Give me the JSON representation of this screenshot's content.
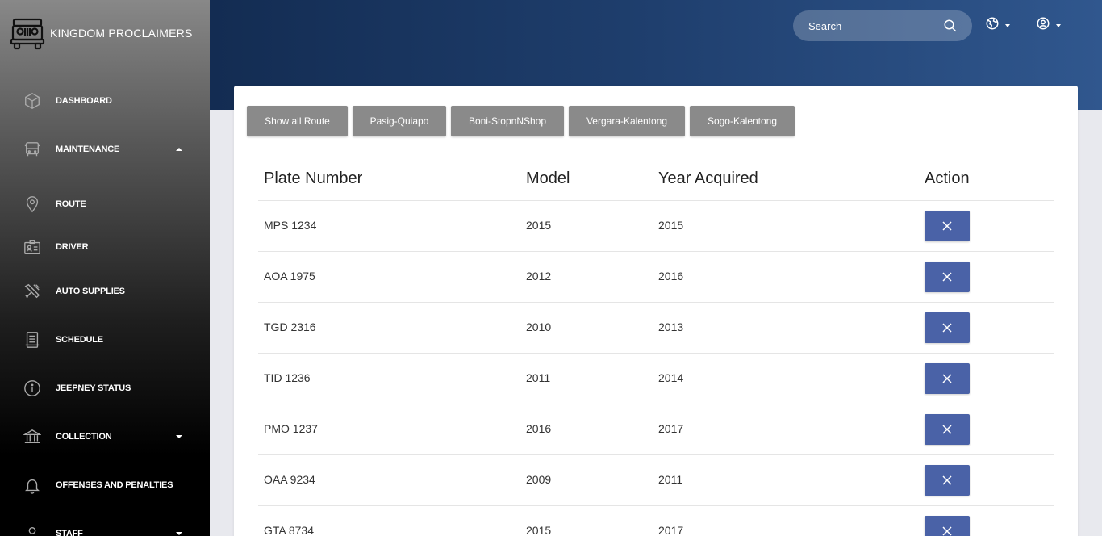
{
  "brand": {
    "name": "KINGDOM PROCLAIMERS",
    "logo_icon": "jeep-icon"
  },
  "nav": [
    {
      "label": "DASHBOARD",
      "icon": "cube-icon",
      "caret": null
    },
    {
      "label": "MAINTENANCE",
      "icon": "bus-icon",
      "caret": "up"
    },
    {
      "label": "ROUTE",
      "icon": "map-pin-icon",
      "caret": null
    },
    {
      "label": "DRIVER",
      "icon": "id-card-icon",
      "caret": null
    },
    {
      "label": "AUTO SUPPLIES",
      "icon": "tools-icon",
      "caret": null
    },
    {
      "label": "SCHEDULE",
      "icon": "document-icon",
      "caret": null
    },
    {
      "label": "JEEPNEY STATUS",
      "icon": "info-icon",
      "caret": null
    },
    {
      "label": "COLLECTION",
      "icon": "bank-icon",
      "caret": "down"
    },
    {
      "label": "OFFENSES AND PENALTIES",
      "icon": "bell-icon",
      "caret": null
    },
    {
      "label": "STAFF",
      "icon": "user-icon",
      "caret": "down"
    }
  ],
  "header": {
    "search_placeholder": "Search",
    "language_icon": "globe-icon",
    "account_icon": "user-circle-icon"
  },
  "filters": [
    "Show all Route",
    "Pasig-Quiapo",
    "Boni-StopnNShop",
    "Vergara-Kalentong",
    "Sogo-Kalentong"
  ],
  "table": {
    "headers": [
      "Plate Number",
      "Model",
      "Year Acquired",
      "Action"
    ],
    "rows": [
      [
        "MPS 1234",
        "2015",
        "2015"
      ],
      [
        "AOA 1975",
        "2012",
        "2016"
      ],
      [
        "TGD 2316",
        "2010",
        "2013"
      ],
      [
        "TID 1236",
        "2011",
        "2014"
      ],
      [
        "PMO 1237",
        "2016",
        "2017"
      ],
      [
        "OAA 9234",
        "2009",
        "2011"
      ],
      [
        "GTA 8734",
        "2015",
        "2017"
      ]
    ],
    "action_icon": "close-icon"
  },
  "colors": {
    "accent": "#4a62a7",
    "header_dark": "#132c52",
    "filter_button": "#8a8a8a"
  }
}
